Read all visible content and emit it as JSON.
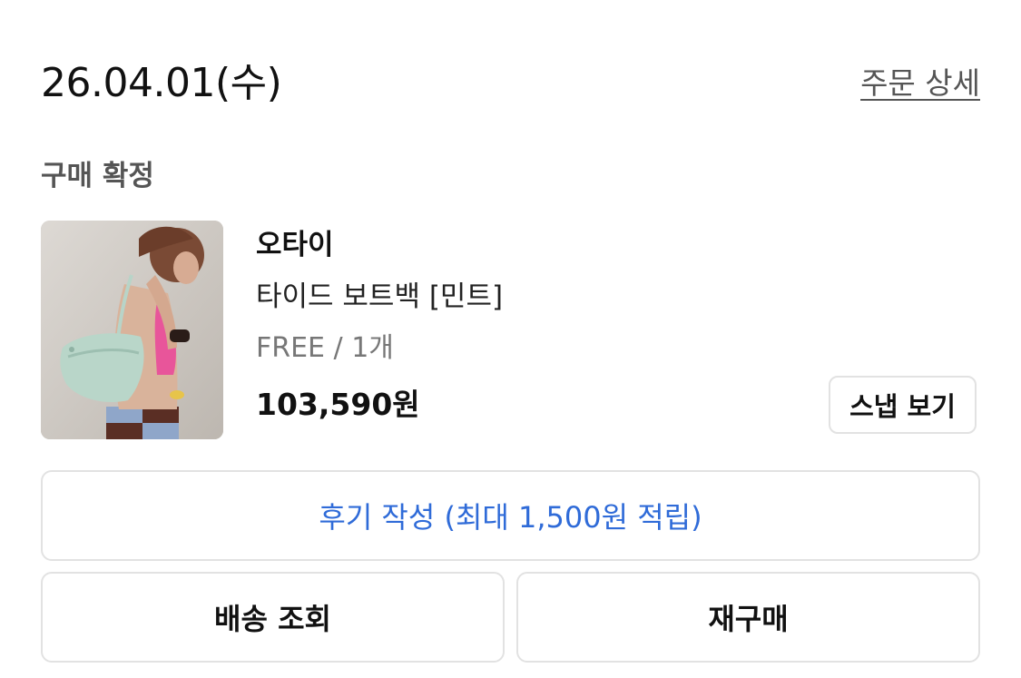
{
  "order": {
    "date": "26.04.01(수)",
    "detail_link": "주문 상세",
    "status": "구매 확정"
  },
  "product": {
    "brand": "오타이",
    "name": "타이드 보트백 [민트]",
    "option": "FREE / 1개",
    "price": "103,590원",
    "snap_button": "스냅 보기"
  },
  "actions": {
    "review_button": "후기 작성 (최대 1,500원 적립)",
    "shipping_button": "배송 조회",
    "rebuy_button": "재구매"
  },
  "colors": {
    "accent_blue": "#2f6bd8",
    "border": "#e2e2e2",
    "muted_text": "#777777"
  }
}
